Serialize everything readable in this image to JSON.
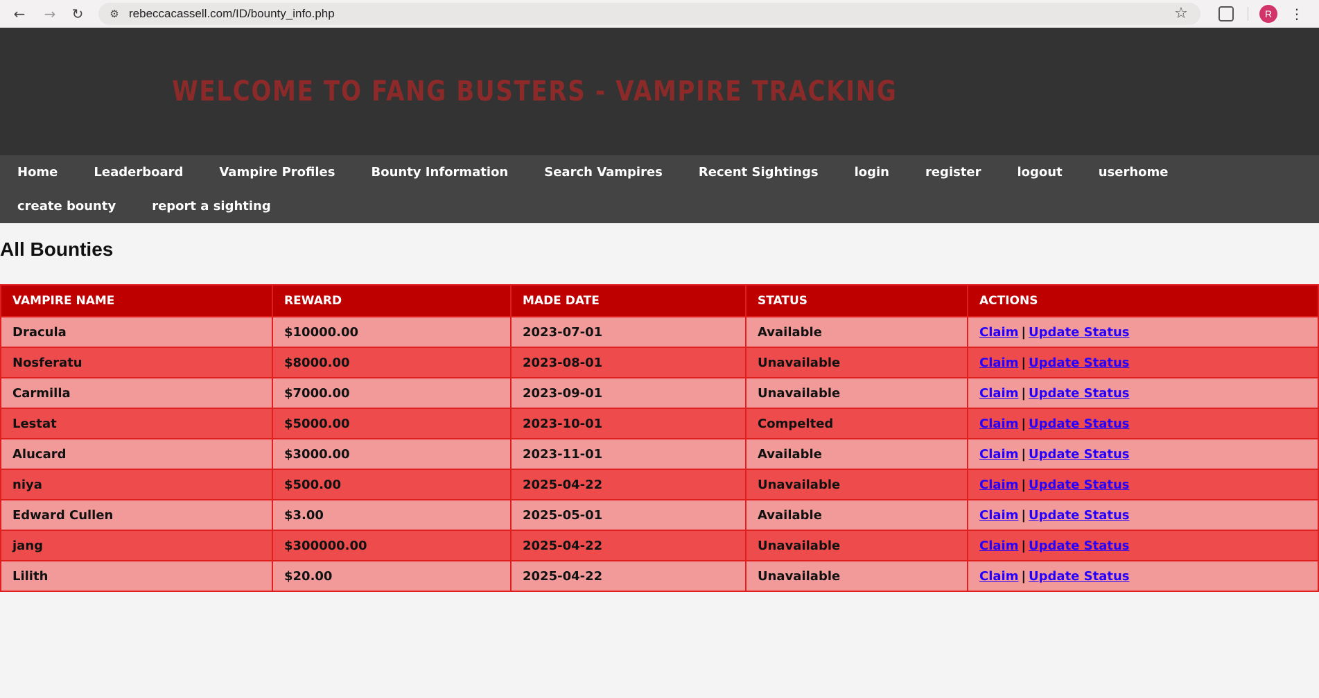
{
  "browser": {
    "url": "rebeccacassell.com/ID/bounty_info.php",
    "avatar_letter": "R"
  },
  "banner": {
    "title": "Welcome to Fang Busters - Vampire Tracking"
  },
  "nav": {
    "row1": [
      "Home",
      "Leaderboard",
      "Vampire Profiles",
      "Bounty Information",
      "Search Vampires",
      "Recent Sightings",
      "login",
      "register",
      "logout",
      "userhome"
    ],
    "row2": [
      "create bounty",
      "report a sighting"
    ]
  },
  "section_title": "All Bounties",
  "table": {
    "headers": [
      "Vampire Name",
      "Reward",
      "Made Date",
      "Status",
      "Actions"
    ],
    "claim_label": "Claim",
    "update_label": "Update Status",
    "separator": "|",
    "rows": [
      {
        "name": "Dracula",
        "reward": "$10000.00",
        "date": "2023-07-01",
        "status": "Available"
      },
      {
        "name": "Nosferatu",
        "reward": "$8000.00",
        "date": "2023-08-01",
        "status": "Unavailable"
      },
      {
        "name": "Carmilla",
        "reward": "$7000.00",
        "date": "2023-09-01",
        "status": "Unavailable"
      },
      {
        "name": "Lestat",
        "reward": "$5000.00",
        "date": "2023-10-01",
        "status": "Compelted"
      },
      {
        "name": "Alucard",
        "reward": "$3000.00",
        "date": "2023-11-01",
        "status": "Available"
      },
      {
        "name": "niya",
        "reward": "$500.00",
        "date": "2025-04-22",
        "status": "Unavailable"
      },
      {
        "name": "Edward Cullen",
        "reward": "$3.00",
        "date": "2025-05-01",
        "status": "Available"
      },
      {
        "name": "jang",
        "reward": "$300000.00",
        "date": "2025-04-22",
        "status": "Unavailable"
      },
      {
        "name": "Lilith",
        "reward": "$20.00",
        "date": "2025-04-22",
        "status": "Unavailable"
      }
    ]
  }
}
